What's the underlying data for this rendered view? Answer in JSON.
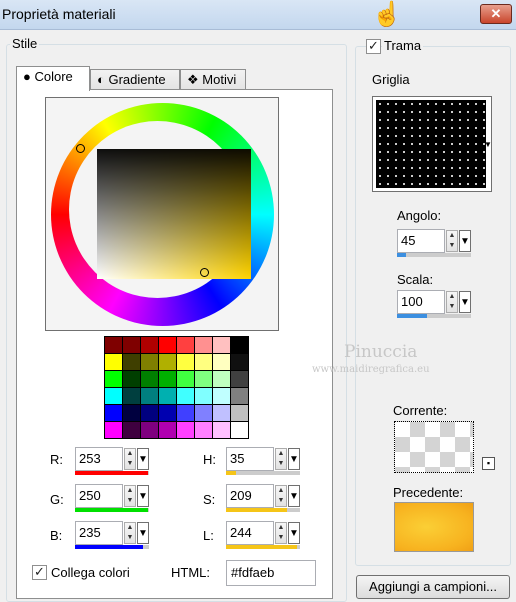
{
  "window": {
    "title": "Proprietà materiali",
    "close_label": "✕"
  },
  "stile": {
    "label": "Stile",
    "tabs": [
      {
        "label": "Colore",
        "icon": "filled-circle-icon"
      },
      {
        "label": "Gradiente",
        "icon": "half-circle-icon"
      },
      {
        "label": "Motivi",
        "icon": "pattern-icon"
      }
    ],
    "palette": [
      [
        "#7f0000",
        "#7f0000",
        "#b00000",
        "#ff0000",
        "#ff4040",
        "#ff9090",
        "#ffc0c0",
        "#000000"
      ],
      [
        "#ffff00",
        "#3f3f00",
        "#7f7f00",
        "#b0b000",
        "#ffff40",
        "#ffff80",
        "#ffffc0",
        "#101010"
      ],
      [
        "#00ff00",
        "#003f00",
        "#007f00",
        "#00b000",
        "#40ff40",
        "#80ff80",
        "#c0ffc0",
        "#404040"
      ],
      [
        "#00ffff",
        "#003f3f",
        "#007f7f",
        "#00b0b0",
        "#40ffff",
        "#80ffff",
        "#c0ffff",
        "#808080"
      ],
      [
        "#0000ff",
        "#00003f",
        "#00007f",
        "#0000b0",
        "#4040ff",
        "#8080ff",
        "#c0c0ff",
        "#c0c0c0"
      ],
      [
        "#ff00ff",
        "#3f003f",
        "#7f007f",
        "#b000b0",
        "#ff40ff",
        "#ff80ff",
        "#ffc0ff",
        "#ffffff"
      ]
    ],
    "r": {
      "label": "R:",
      "value": "253",
      "color": "#ff0000",
      "level": 0.99
    },
    "g": {
      "label": "G:",
      "value": "250",
      "color": "#00e000",
      "level": 0.98
    },
    "b": {
      "label": "B:",
      "value": "235",
      "color": "#0000ff",
      "level": 0.92
    },
    "h": {
      "label": "H:",
      "value": "35",
      "color": "#f5c518",
      "level": 0.14
    },
    "s": {
      "label": "S:",
      "value": "209",
      "color": "#f5c518",
      "level": 0.82
    },
    "l": {
      "label": "L:",
      "value": "244",
      "color": "#f5c518",
      "level": 0.96
    },
    "link_colors": {
      "label": "Collega colori",
      "checked": true
    },
    "html": {
      "label": "HTML:",
      "value": "#fdfaeb"
    }
  },
  "trama": {
    "label": "Trama",
    "checked": true,
    "griglia_label": "Griglia",
    "angolo": {
      "label": "Angolo:",
      "value": "45",
      "level": 0.12
    },
    "scala": {
      "label": "Scala:",
      "value": "100",
      "level": 0.4
    },
    "corrente_label": "Corrente:",
    "precedente_label": "Precedente:",
    "add_button": "Aggiungi a campioni..."
  },
  "watermark": {
    "name": "Pinuccia",
    "url": "www.maidiregrafica.eu"
  }
}
